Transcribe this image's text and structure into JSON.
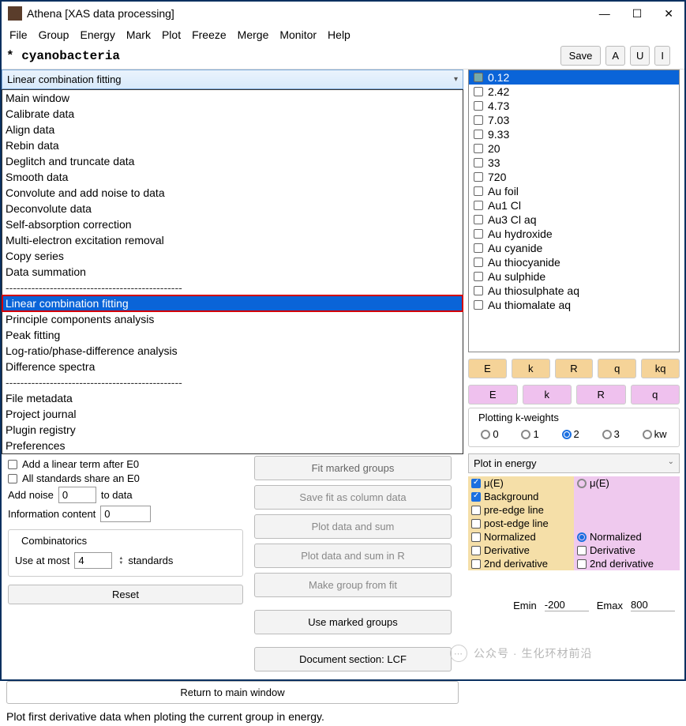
{
  "window": {
    "title": "Athena [XAS data processing]"
  },
  "menu": [
    "File",
    "Group",
    "Energy",
    "Mark",
    "Plot",
    "Freeze",
    "Merge",
    "Monitor",
    "Help"
  ],
  "toprow": {
    "name": "* cyanobacteria",
    "save": "Save",
    "a": "A",
    "u": "U",
    "i": "I"
  },
  "dd_selected": "Linear combination fitting",
  "dd_items": [
    {
      "t": "Main window"
    },
    {
      "t": "Calibrate data"
    },
    {
      "t": "Align data"
    },
    {
      "t": "Rebin data"
    },
    {
      "t": "Deglitch and truncate data"
    },
    {
      "t": "Smooth data"
    },
    {
      "t": "Convolute and add noise to data"
    },
    {
      "t": "Deconvolute data"
    },
    {
      "t": "Self-absorption correction"
    },
    {
      "t": "Multi-electron excitation removal"
    },
    {
      "t": "Copy series"
    },
    {
      "t": "Data summation"
    },
    {
      "sep": true
    },
    {
      "t": "Linear combination fitting",
      "sel": true,
      "red": true
    },
    {
      "t": "Principle components analysis"
    },
    {
      "t": "Peak fitting"
    },
    {
      "t": "Log-ratio/phase-difference analysis"
    },
    {
      "t": "Difference spectra"
    },
    {
      "sep": true
    },
    {
      "t": "File metadata"
    },
    {
      "t": "Project journal"
    },
    {
      "t": "Plugin registry"
    },
    {
      "t": "Preferences"
    }
  ],
  "panel_left": {
    "add_linear": "Add a linear term after E0",
    "all_std": "All standards share an E0",
    "add_noise_lbl": "Add noise",
    "add_noise_val": "0",
    "add_noise_to": "to data",
    "info_lbl": "Information content",
    "info_val": "0",
    "combo_title": "Combinatorics",
    "use_most": "Use at most",
    "use_most_val": "4",
    "standards": "standards",
    "reset": "Reset"
  },
  "panel_mid": {
    "b0": "Fit marked groups",
    "b1": "Save fit as column data",
    "b2": "Plot data and sum",
    "b3": "Plot data and sum in R",
    "b4": "Make group from fit",
    "b5": "Use marked groups",
    "b6": "Document section: LCF"
  },
  "return_btn": "Return to main window",
  "status": "Plot first derivative data when ploting the current group in energy.",
  "datalist": [
    "0.12",
    "2.42",
    "4.73",
    "7.03",
    "9.33",
    "20",
    "33",
    "720",
    "Au foil",
    "Au1 Cl",
    "Au3 Cl aq",
    "Au hydroxide",
    "Au cyanide",
    "Au thiocyanide",
    "Au sulphide",
    "Au thiosulphate aq",
    "Au thiomalate aq"
  ],
  "plot_btns_top": [
    "E",
    "k",
    "R",
    "q",
    "kq"
  ],
  "plot_btns_bot": [
    "E",
    "k",
    "R",
    "q"
  ],
  "kw_label": "Plotting k-weights",
  "kw_opts": [
    "0",
    "1",
    "2",
    "3",
    "kw"
  ],
  "plot_select": "Plot in energy",
  "opts_left_label": "μ(E)",
  "opts_left": [
    {
      "t": "μ(E)",
      "on": true
    },
    {
      "t": "Background",
      "on": true
    },
    {
      "t": "pre-edge line"
    },
    {
      "t": "post-edge line"
    },
    {
      "t": "Normalized"
    },
    {
      "t": "Derivative"
    },
    {
      "t": "2nd derivative"
    }
  ],
  "opts_right": [
    {
      "t": "μ(E)",
      "radio": true
    },
    {
      "space": true
    },
    {
      "space": true
    },
    {
      "space": true
    },
    {
      "t": "Normalized",
      "radio": true,
      "on": true
    },
    {
      "t": "Derivative"
    },
    {
      "t": "2nd derivative"
    }
  ],
  "emin_lbl": "Emin",
  "emin_val": "-200",
  "emax_lbl": "Emax",
  "emax_val": "800",
  "overlay": "公众号 · 生化环材前沿"
}
